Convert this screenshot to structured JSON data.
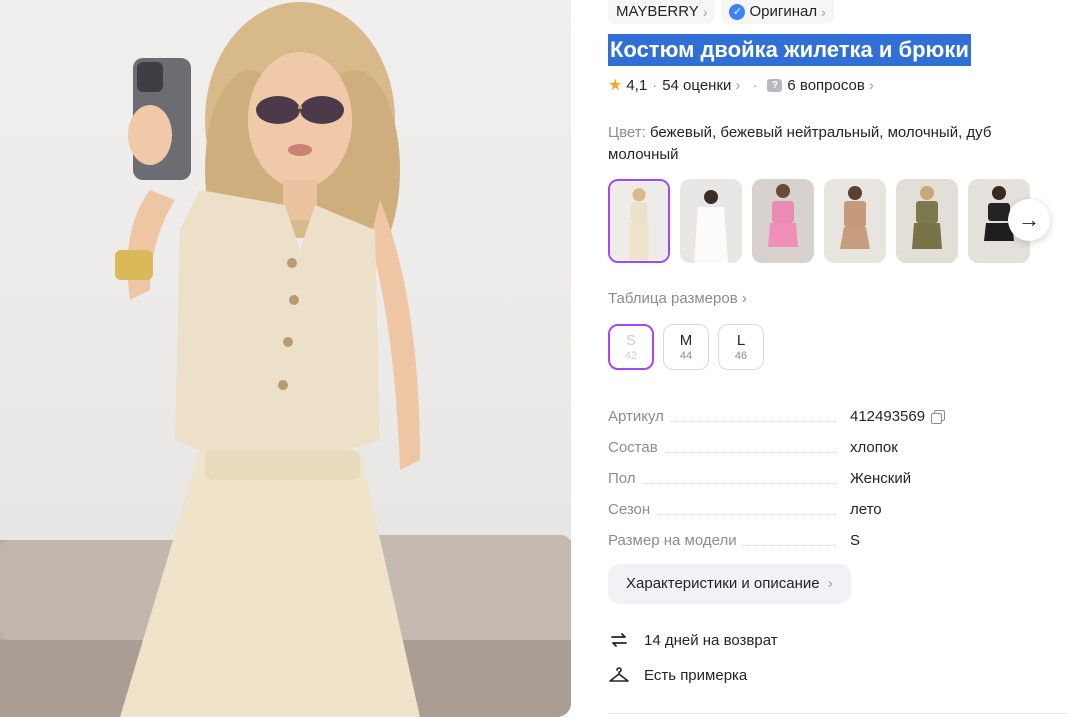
{
  "product": {
    "brand": "MAYBERRY",
    "original_label": "Оригинал",
    "title": "Костюм двойка жилетка и брюки",
    "rating": "4,1",
    "reviews": "54 оценки",
    "questions": "6 вопросов",
    "color_label": "Цвет:",
    "color_value": "бежевый, бежевый нейтральный, молочный, дуб молочный",
    "size_table_label": "Таблица размеров"
  },
  "thumbnails": [
    {
      "name": "beige-suit",
      "selected": true
    },
    {
      "name": "white-set",
      "selected": false
    },
    {
      "name": "pink-set",
      "selected": false
    },
    {
      "name": "brown-set",
      "selected": false
    },
    {
      "name": "olive-set",
      "selected": false
    },
    {
      "name": "black-set",
      "selected": false
    }
  ],
  "sizes": [
    {
      "name": "S",
      "num": "42",
      "selected": true
    },
    {
      "name": "M",
      "num": "44",
      "selected": false
    },
    {
      "name": "L",
      "num": "46",
      "selected": false
    }
  ],
  "specs": [
    {
      "key": "Артикул",
      "value": "412493569"
    },
    {
      "key": "Состав",
      "value": "хлопок"
    },
    {
      "key": "Пол",
      "value": "Женский"
    },
    {
      "key": "Сезон",
      "value": "лето"
    },
    {
      "key": "Размер на модели",
      "value": "S"
    }
  ],
  "chars_button": "Характеристики и описание",
  "features": [
    {
      "icon": "return-arrows-icon",
      "label": "14 дней на возврат"
    },
    {
      "icon": "hanger-icon",
      "label": "Есть примерка"
    }
  ],
  "colors": {
    "accent": "#a246ff",
    "selection": "#2f6fd6",
    "star": "#f5a623",
    "verified": "#3b82f6"
  }
}
